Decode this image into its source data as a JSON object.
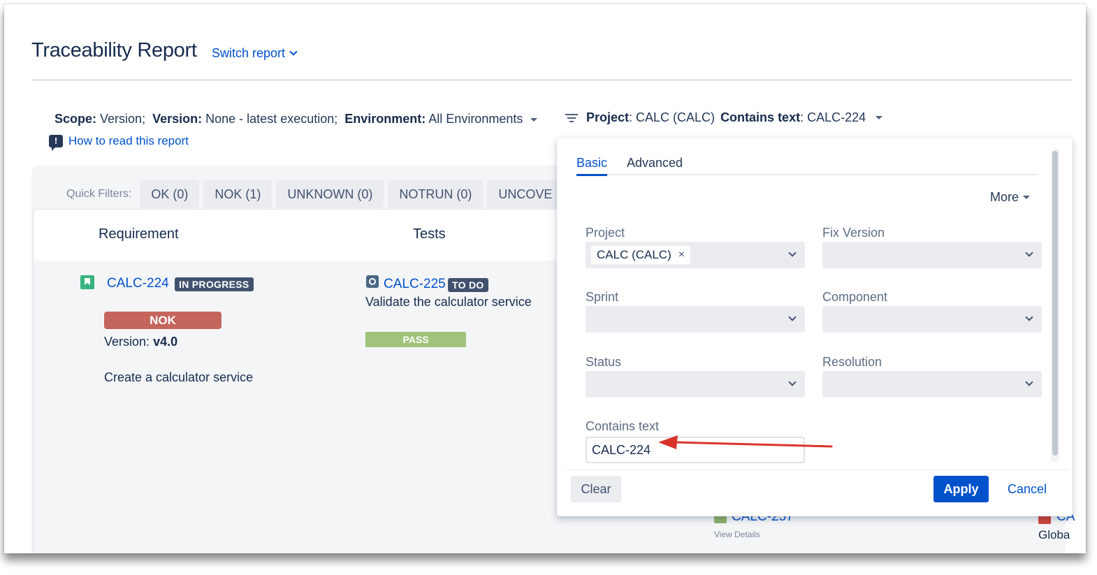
{
  "header": {
    "title": "Traceability Report",
    "switch_report": "Switch report"
  },
  "scope": {
    "scope_label": "Scope:",
    "scope_value": "Version;",
    "version_label": "Version:",
    "version_value": "None - latest execution;",
    "environment_label": "Environment:",
    "environment_value": "All Environments"
  },
  "filter_summary": {
    "project_label": "Project",
    "project_value": ": CALC (CALC)",
    "contains_label": "Contains text",
    "contains_value": ": CALC-224"
  },
  "how_to": "How to read this report",
  "quick_filters": {
    "label": "Quick Filters:",
    "buttons": [
      "OK (0)",
      "NOK (1)",
      "UNKNOWN (0)",
      "NOTRUN (0)",
      "UNCOVE"
    ]
  },
  "table": {
    "headers": [
      "Requirement",
      "Tests"
    ],
    "requirement": {
      "key": "CALC-224",
      "status": "IN PROGRESS",
      "result": "NOK",
      "version_label": "Version:",
      "version_value": "v4.0",
      "summary": "Create a calculator service"
    },
    "test": {
      "key": "CALC-225",
      "status": "TO DO",
      "summary": "Validate the calculator service",
      "result": "PASS"
    },
    "peek": {
      "link1": "CALC-257",
      "sub1": "View Details",
      "link2": "CA",
      "sub2": "Globa"
    }
  },
  "panel": {
    "tabs": [
      "Basic",
      "Advanced"
    ],
    "more": "More",
    "fields": {
      "project": "Project",
      "project_chip": "CALC (CALC)",
      "fix_version": "Fix Version",
      "sprint": "Sprint",
      "component": "Component",
      "status": "Status",
      "resolution": "Resolution",
      "contains_text": "Contains text",
      "contains_text_value": "CALC-224"
    },
    "buttons": {
      "clear": "Clear",
      "apply": "Apply",
      "cancel": "Cancel"
    }
  },
  "colors": {
    "accent": "#0052CC",
    "nok": "#c5665c",
    "pass": "#a0c27a",
    "annotation_arrow": "#d9342b"
  }
}
